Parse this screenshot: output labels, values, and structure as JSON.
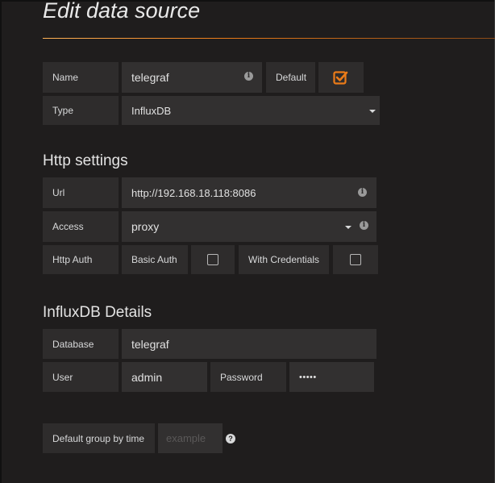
{
  "page": {
    "title": "Edit data source"
  },
  "general": {
    "name_label": "Name",
    "name_value": "telegraf",
    "default_label": "Default",
    "default_checked": true,
    "type_label": "Type",
    "type_value": "InfluxDB"
  },
  "http": {
    "section_title": "Http settings",
    "url_label": "Url",
    "url_value": "http://192.168.18.118:8086",
    "access_label": "Access",
    "access_value": "proxy",
    "auth_label": "Http Auth",
    "basic_auth_label": "Basic Auth",
    "basic_auth_checked": false,
    "with_credentials_label": "With Credentials",
    "with_credentials_checked": false
  },
  "influx": {
    "section_title": "InfluxDB Details",
    "database_label": "Database",
    "database_value": "telegraf",
    "user_label": "User",
    "user_value": "admin",
    "password_label": "Password",
    "password_value": "•••••",
    "group_by_label": "Default group by time",
    "group_by_placeholder": "example"
  },
  "icons": {
    "info": "info-icon",
    "help": "question-icon",
    "check": "checkmark-icon",
    "caret": "caret-down-icon"
  },
  "colors": {
    "accent": "#eb7b18",
    "background": "#1f1d1d",
    "field": "#2e2c2c"
  }
}
